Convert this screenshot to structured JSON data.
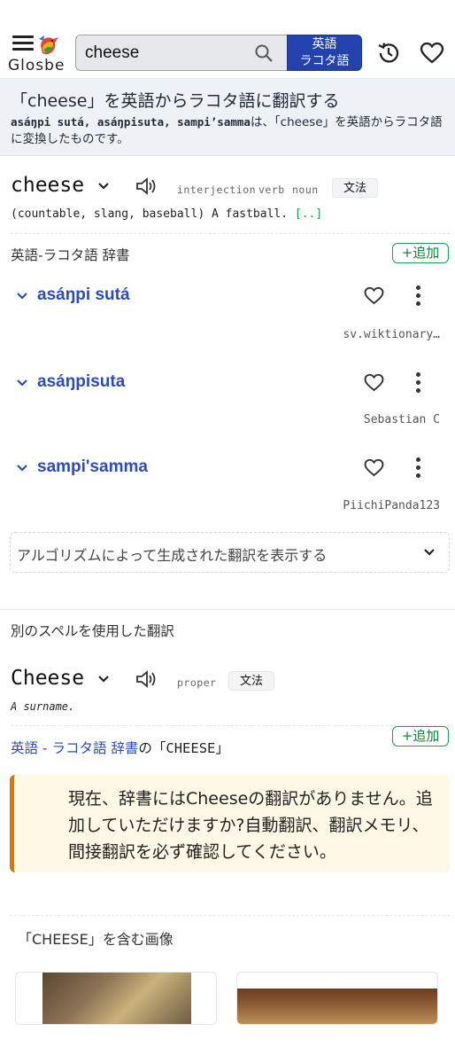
{
  "header": {
    "logo": "Glosbe",
    "search_value": "cheese",
    "search_placeholder": "",
    "lang_line1": "英語",
    "lang_line2": "ラコタ語"
  },
  "banner": {
    "title": "「cheese」を英語からラコタ語に翻訳する",
    "sub_bold": "asáŋpi sutá, asáŋpisuta, sampi’samma",
    "sub_rest": "は、「cheese」を英語からラコタ語に変換したものです。"
  },
  "entry1": {
    "word": "cheese",
    "pos": [
      "interjection",
      "verb",
      "noun"
    ],
    "grammar": "文法",
    "definition": "(countable, slang, baseball) A fastball.",
    "more": "[..]"
  },
  "dictionary": {
    "label": "英語-ラコタ語 辞書",
    "add": "+追加",
    "translations": [
      {
        "word": "asáŋpi sutá",
        "source": "sv.wiktionary…"
      },
      {
        "word": "asáŋpisuta",
        "source": "Sebastian C"
      },
      {
        "word": "sampi'samma",
        "source": "PiichiPanda123"
      }
    ],
    "algo": "アルゴリズムによって生成された翻訳を表示する"
  },
  "alt": {
    "label": "別のスペルを使用した翻訳",
    "word": "Cheese",
    "pos": "proper",
    "grammar": "文法",
    "definition": "A surname.",
    "dict_link_a": "英語 - ラコタ語 辞書",
    "dict_link_b": "の「CHEESE」",
    "add": "+追加",
    "notice": "現在、辞書にはCheeseの翻訳がありません。追加していただけますか?自動翻訳、翻訳メモリ、間接翻訳を必ず確認してください。"
  },
  "images": {
    "label": "「CHEESE」を含む画像"
  },
  "colors": {
    "brand_blue": "#2442ad",
    "link_blue": "#2e4bb7",
    "add_green": "#16a34a",
    "notice_bg": "#fff8e6",
    "notice_accent": "#d97706"
  }
}
